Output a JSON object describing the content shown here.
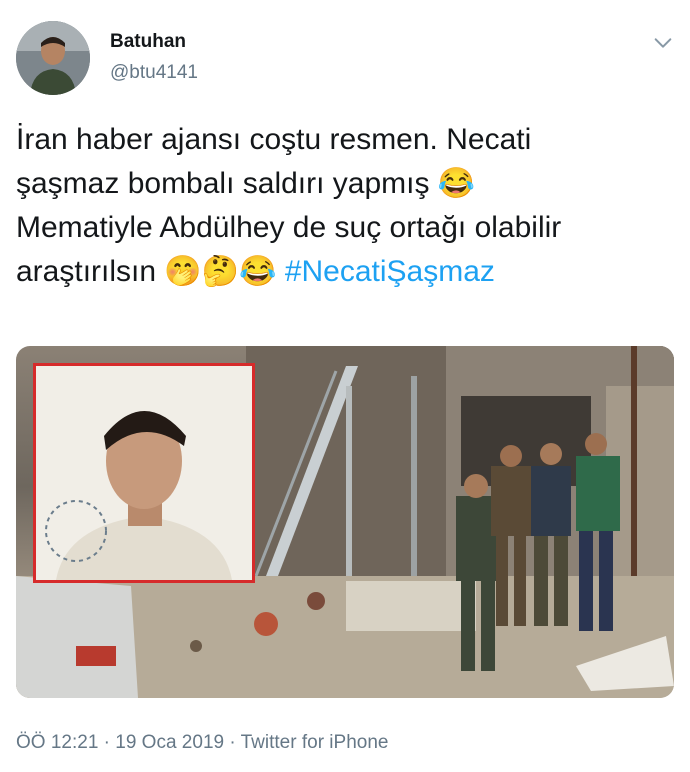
{
  "author": {
    "name": "Batuhan",
    "handle": "@btu4141"
  },
  "tweet": {
    "line1": "İran haber ajansı coştu resmen. Necati",
    "line2": "şaşmaz bombalı saldırı yapmış",
    "line3": "Mematiyle Abdülhey de suç ortağı olabilir",
    "line4": "araştırılsın",
    "hashtag": "#NecatiŞaşmaz",
    "emoji_after_line2": "😂",
    "emojis_line4": [
      "🤭",
      "🤔",
      "😂"
    ]
  },
  "meta": {
    "footer": "ÖÖ 12:21 · 19 Oca 2019 · Twitter for iPhone"
  },
  "icons": {
    "menu": "chevron-down-icon"
  },
  "colors": {
    "link": "#1da1f2",
    "secondary": "#657786",
    "inset_border": "#d62b2b"
  }
}
